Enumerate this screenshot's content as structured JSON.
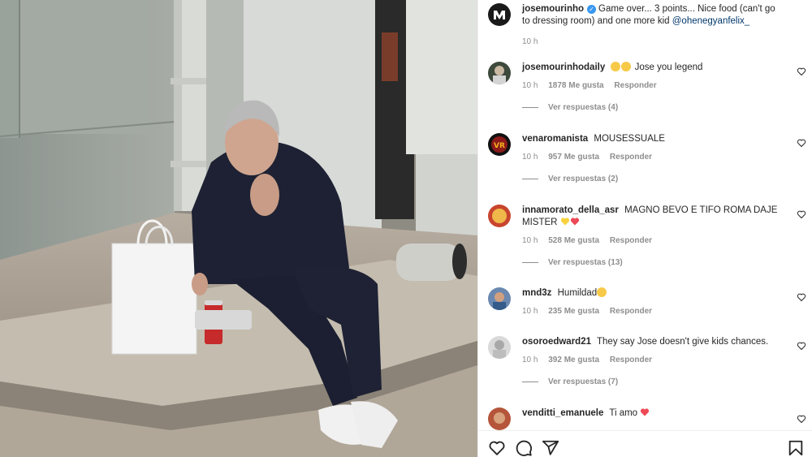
{
  "post": {
    "author": "josemourinho",
    "caption": "Game over... 3 points... Nice food (can't go to dressing room) and one more kid",
    "mention": "@ohenegyanfelix_",
    "time": "10 h"
  },
  "comments": [
    {
      "user": "josemourinhodaily",
      "text": "Jose you legend",
      "emoji_prefix": [
        "😅",
        "😅"
      ],
      "time": "10 h",
      "likes": "1878 Me gusta",
      "reply": "Responder",
      "replies": "Ver respuestas (4)"
    },
    {
      "user": "venaromanista",
      "text": "MOUSESSUALE",
      "time": "10 h",
      "likes": "957 Me gusta",
      "reply": "Responder",
      "replies": "Ver respuestas (2)"
    },
    {
      "user": "innamorato_della_asr",
      "text": "MAGNO BEVO E TIFO ROMA DAJE MISTER",
      "emoji_suffix": [
        "💛",
        "❤️"
      ],
      "time": "10 h",
      "likes": "528 Me gusta",
      "reply": "Responder",
      "replies": "Ver respuestas (13)"
    },
    {
      "user": "mnd3z",
      "text": "Humildad",
      "emoji_suffix": [
        "😱"
      ],
      "time": "10 h",
      "likes": "235 Me gusta",
      "reply": "Responder"
    },
    {
      "user": "osoroedward21",
      "text": "They say Jose doesn't give kids chances.",
      "time": "10 h",
      "likes": "392 Me gusta",
      "reply": "Responder",
      "replies": "Ver respuestas (7)"
    },
    {
      "user": "venditti_emanuele",
      "text": "Ti amo",
      "emoji_suffix": [
        "❤️"
      ]
    }
  ],
  "icons": [
    "heart-icon",
    "comment-icon",
    "share-icon",
    "bookmark-icon",
    "verified-badge-icon"
  ],
  "colors": {
    "link": "#00376b",
    "muted": "#8e8e8e",
    "verified": "#3897f0",
    "heart_red": "#ed4956",
    "heart_yellow": "#f7d23f"
  }
}
